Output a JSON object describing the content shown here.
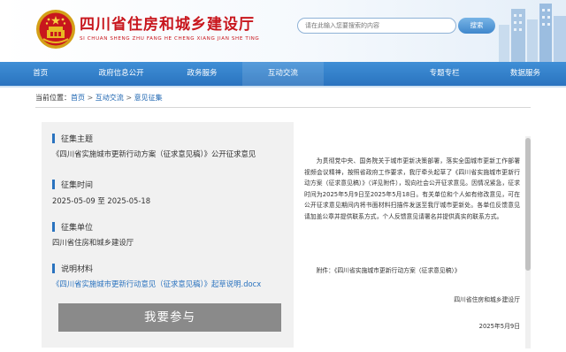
{
  "site": {
    "title": "四川省住房和城乡建设厅",
    "subtitle": "SI CHUAN SHENG ZHU FANG HE CHENG XIANG JIAN SHE TING"
  },
  "search": {
    "placeholder": "请在此输入您要搜索的内容",
    "button_label": "搜索"
  },
  "nav": {
    "items": [
      "首页",
      "政府信息公开",
      "政务服务",
      "互动交流",
      "",
      "专题专栏",
      "数据服务"
    ]
  },
  "breadcrumb": {
    "label": "当前位置：",
    "items": [
      "首页",
      "互动交流",
      "意见征集"
    ],
    "separator": ">"
  },
  "panel": {
    "topic_label": "征集主题",
    "topic": "《四川省实施城市更新行动方案（征求意见稿）》公开征求意见",
    "period_label": "征集时间",
    "period": "2025-05-09 至 2025-05-18",
    "org_label": "征集单位",
    "org": "四川省住房和城乡建设厅",
    "material_label": "说明材料",
    "material": "《四川省实施城市更新行动意见（征求意见稿）》起草说明.docx",
    "join_label": "我要参与"
  },
  "letter": {
    "body": "为贯彻党中央、国务院关于城市更新决策部署，落实全国城市更新工作部署视频会议精神，按照省政府工作要求，我厅牵头起草了《四川省实施城市更新行动方案（征求意见稿）》（详见附件），现向社会公开征求意见。因情况紧急，征求时间为2025年5月9日至2025年5月18日。有关单位和个人如有修改意见，可在公开征求意见期间内将书面材料扫描件发送至我厅城市更新处。各单位反馈意见请加盖公章并提供联系方式，个人反馈意见请署名并提供真实的联系方式。",
    "attachment": "附件：《四川省实施城市更新行动方案（征求意见稿）》",
    "signature": "四川省住房和城乡建设厅",
    "date": "2025年5月9日"
  },
  "colors": {
    "brand_red": "#c8161d",
    "nav_blue": "#2a73bf",
    "link_blue": "#1a63b0",
    "button_gray": "#8a8a8a"
  }
}
